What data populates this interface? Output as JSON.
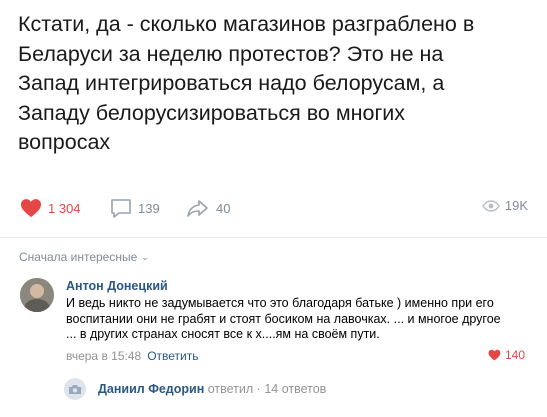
{
  "post": {
    "text": "Кстати, да - сколько магазинов разграблено в\nБеларуси за неделю протестов? Это не на\nЗапад интегрироваться надо белорусам, а\nЗападу белорусизироваться во многих\nвопросах"
  },
  "actions": {
    "likes": "1 304",
    "comments": "139",
    "shares": "40",
    "views": "19K"
  },
  "sort": {
    "label": "Сначала интересные"
  },
  "comment": {
    "author": "Антон Донецкий",
    "text": "И ведь никто не задумывается что это благодаря батьке ) именно при его\nвоспитании они не грабят и стоят босиком на лавочках. ... и многое другое\n... в других странах сносят все к х....ям на своём пути.",
    "time": "вчера в 15:48",
    "reply_label": "Ответить",
    "likes": "140"
  },
  "replies": {
    "name": "Даниил Федорин",
    "verb": "ответил",
    "count": "14 ответов"
  },
  "colors": {
    "accent_link": "#2a5885",
    "like_red": "#e64646",
    "muted": "#828a99"
  }
}
